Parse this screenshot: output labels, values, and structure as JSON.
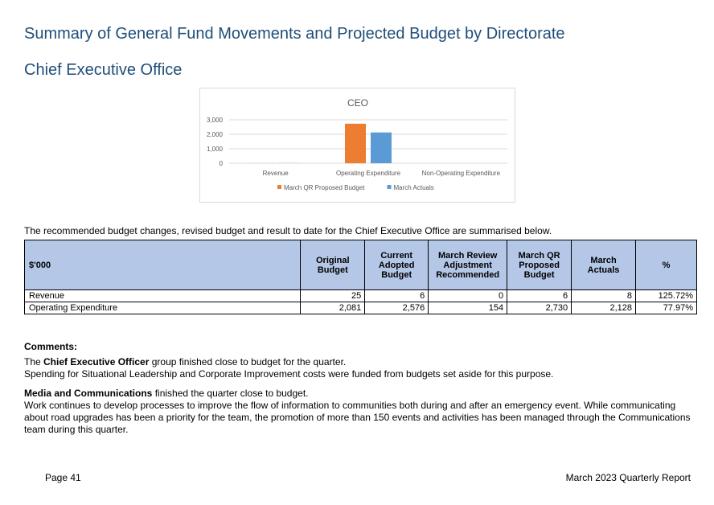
{
  "title": "Summary of General Fund Movements and Projected Budget by Directorate",
  "subtitle": "Chief Executive Office",
  "chart_data": {
    "type": "bar",
    "title": "CEO",
    "categories": [
      "Revenue",
      "Operating Expenditure",
      "Non-Operating Expenditure"
    ],
    "series": [
      {
        "name": "March QR Proposed Budget",
        "values": [
          6,
          2730,
          0
        ],
        "color": "#ed7d31"
      },
      {
        "name": "March Actuals",
        "values": [
          8,
          2128,
          0
        ],
        "color": "#5b9bd5"
      }
    ],
    "ylim": [
      0,
      3000
    ],
    "yticks": [
      "0",
      "1,000",
      "2,000",
      "3,000"
    ],
    "ytick_values": [
      0,
      1000,
      2000,
      3000
    ],
    "grid": true,
    "legend": "bottom"
  },
  "intro": "The recommended budget changes, revised budget and result to date for the Chief Executive Office are summarised below.",
  "table": {
    "headers": [
      "$'000",
      "Original Budget",
      "Current Adopted Budget",
      "March Review Adjustment Recommended",
      "March QR Proposed Budget",
      "March Actuals",
      "%"
    ],
    "rows": [
      [
        "Revenue",
        "25",
        "6",
        "0",
        "6",
        "8",
        "125.72%"
      ],
      [
        "Operating Expenditure",
        "2,081",
        "2,576",
        "154",
        "2,730",
        "2,128",
        "77.97%"
      ]
    ]
  },
  "comments": {
    "heading": "Comments:",
    "p1_pre": "The ",
    "p1_bold": "Chief Executive Officer",
    "p1_post": " group finished close to budget for the quarter.",
    "p1_line2": "Spending for Situational Leadership and Corporate Improvement costs were funded from budgets set aside for this purpose.",
    "p2_bold": "Media and Communications",
    "p2_post": " finished the quarter close to budget.",
    "p2_body": "Work continues to develop processes to improve the flow of information to communities both during and after an emergency event. While communicating about road upgrades has been a priority for the team, the promotion of more than 150 events and activities has been managed through the Communications team during this quarter."
  },
  "footer": {
    "page": "Page 41",
    "report": "March 2023 Quarterly Report"
  }
}
